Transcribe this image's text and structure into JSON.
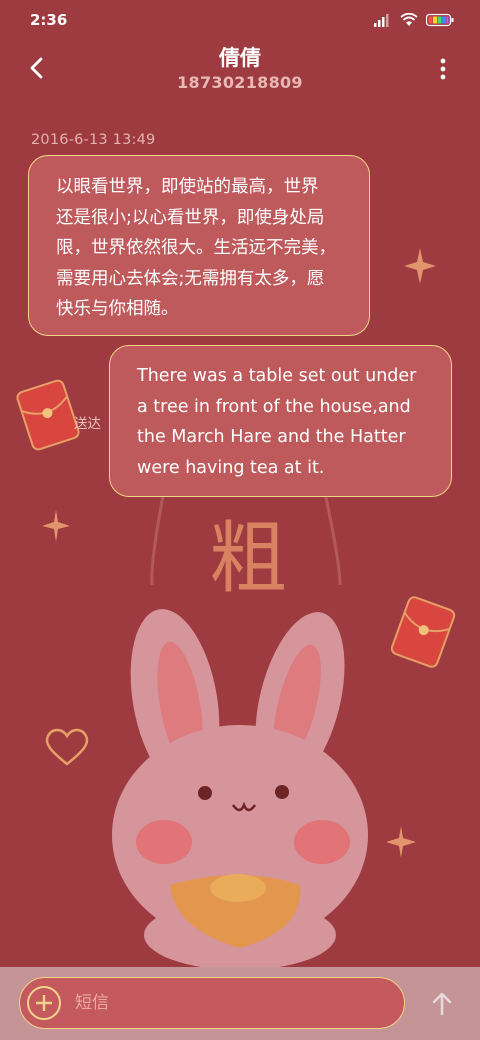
{
  "status_bar": {
    "time": "2:36"
  },
  "header": {
    "contact_name": "倩倩",
    "contact_number": "18730218809",
    "back_icon": "chevron-left-icon",
    "more_icon": "more-vertical-icon"
  },
  "background": {
    "character": "粗"
  },
  "conversation": {
    "timestamp": "2016-6-13 13:49",
    "messages": [
      {
        "direction": "incoming",
        "lines": [
          "以眼看世界，即使站的最高，世界",
          "还是很小;以心看世界，即使身处局",
          "限，世界依然很大。生活远不完美，",
          "需要用心去体会;无需拥有太多，愿",
          "快乐与你相随。"
        ]
      },
      {
        "direction": "outgoing",
        "lines": [
          "There was a table set out under",
          "a tree in front of the house,and",
          "the March Hare and the Hatter",
          "were having tea at it."
        ],
        "status": "送达"
      }
    ]
  },
  "composer": {
    "placeholder": "短信",
    "value": "",
    "add_icon": "plus-icon",
    "send_icon": "arrow-up-icon"
  },
  "colors": {
    "background": "#9e3b40",
    "bubble": "#bf5a5c",
    "bubble_border": "#f2d38a",
    "input_bar": "#c49496"
  }
}
